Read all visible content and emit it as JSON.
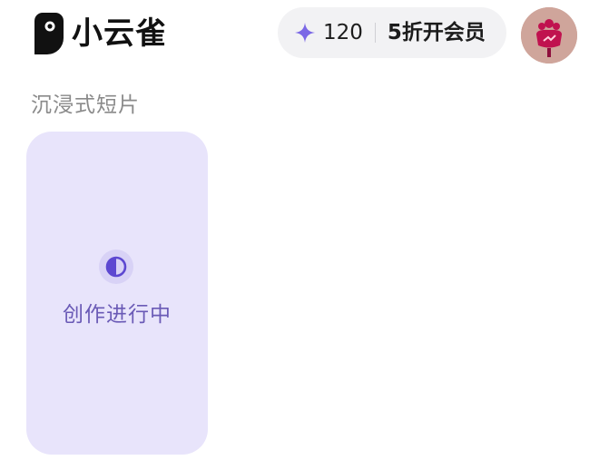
{
  "app": {
    "name": "小云雀",
    "logo_icon": "bird-logo-icon"
  },
  "header": {
    "credits": {
      "icon": "sparkle-icon",
      "icon_color": "#7b68e6",
      "count": "120"
    },
    "vip_label": "5折开会员",
    "avatar_icon": "avatar-image"
  },
  "main": {
    "section_title": "沉浸式短片",
    "cards": [
      {
        "status_icon": "progress-icon",
        "status_text": "创作进行中",
        "background_color": "#e8e4fb",
        "accent_color": "#6a5ab6"
      }
    ]
  }
}
